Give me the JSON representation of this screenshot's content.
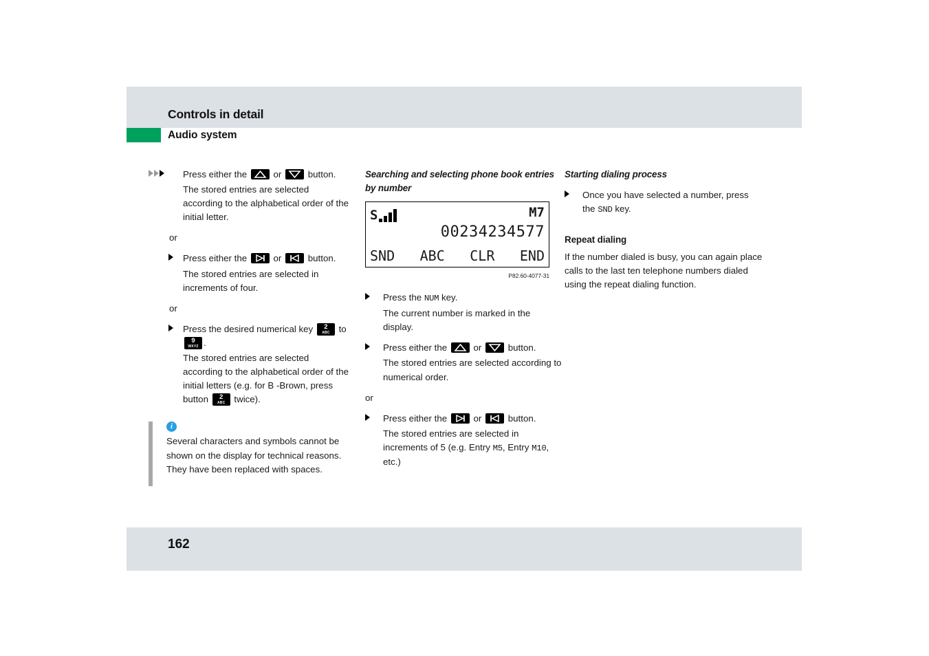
{
  "header": {
    "title": "Controls in detail",
    "subtitle": "Audio system"
  },
  "footer": {
    "page_number": "162"
  },
  "colors": {
    "header_band": "#dce1e6",
    "accent_green": "#00a05d",
    "note_icon_blue": "#2a9fe0",
    "note_bar_gray": "#a8a8a8"
  },
  "icons": {
    "up_button": "arrow-up-button-icon",
    "down_button": "arrow-down-button-icon",
    "next_button": "skip-forward-button-icon",
    "prev_button": "skip-back-button-icon",
    "key_2": {
      "digit": "2",
      "letters": "ABC"
    },
    "key_9": {
      "digit": "9",
      "letters": "WXYZ"
    },
    "info": "info-circle-icon"
  },
  "left_column": {
    "step1": {
      "text_a": "Press either the",
      "text_b": "or",
      "text_c": "button."
    },
    "step1_result": "The stored entries are selected according to the alphabetical order of the initial letter.",
    "or1": "or",
    "step2": {
      "text_a": "Press either the",
      "text_b": "or",
      "text_c": "button."
    },
    "step2_result": "The stored entries are selected in increments of four.",
    "or2": "or",
    "step3": {
      "text_a": "Press the desired numerical key",
      "text_b": "to",
      "text_c": "."
    },
    "step3_result_a": "The stored entries are selected according to the alphabetical order of the initial letters (e.g. for B -Brown, press button",
    "step3_result_b": "twice).",
    "note": "Several characters and symbols cannot be shown on the display for technical reasons. They have been replaced with spaces."
  },
  "middle_column": {
    "heading": "Searching and selecting phone book entries by number",
    "figure": {
      "signal_letter": "S",
      "signal_bars": 4,
      "memory_label": "M7",
      "phone_number": "00234234577",
      "softkeys": [
        "SND",
        "ABC",
        "CLR",
        "END"
      ],
      "caption": "P82.60-4077-31"
    },
    "step1": {
      "text_a": "Press the",
      "key": "NUM",
      "text_b": "key."
    },
    "step1_result": "The current number is marked in the display.",
    "step2": {
      "text_a": "Press either the",
      "text_b": "or",
      "text_c": "button."
    },
    "step2_result": "The stored entries are selected according to numerical order.",
    "or1": "or",
    "step3": {
      "text_a": "Press either the",
      "text_b": "or",
      "text_c": "button."
    },
    "step3_result_a": "The stored entries are selected in increments of 5 (e.g. Entry",
    "step3_result_m5": "M5",
    "step3_result_b": ", Entry",
    "step3_result_m10": "M10",
    "step3_result_c": ", etc.)"
  },
  "right_column": {
    "heading1": "Starting dialing process",
    "step1": {
      "text_a": "Once you have selected a number, press the",
      "key": "SND",
      "text_b": "key."
    },
    "heading2": "Repeat dialing",
    "paragraph": "If the number dialed is busy, you can again place calls to the last ten telephone numbers dialed using the repeat dialing function."
  }
}
